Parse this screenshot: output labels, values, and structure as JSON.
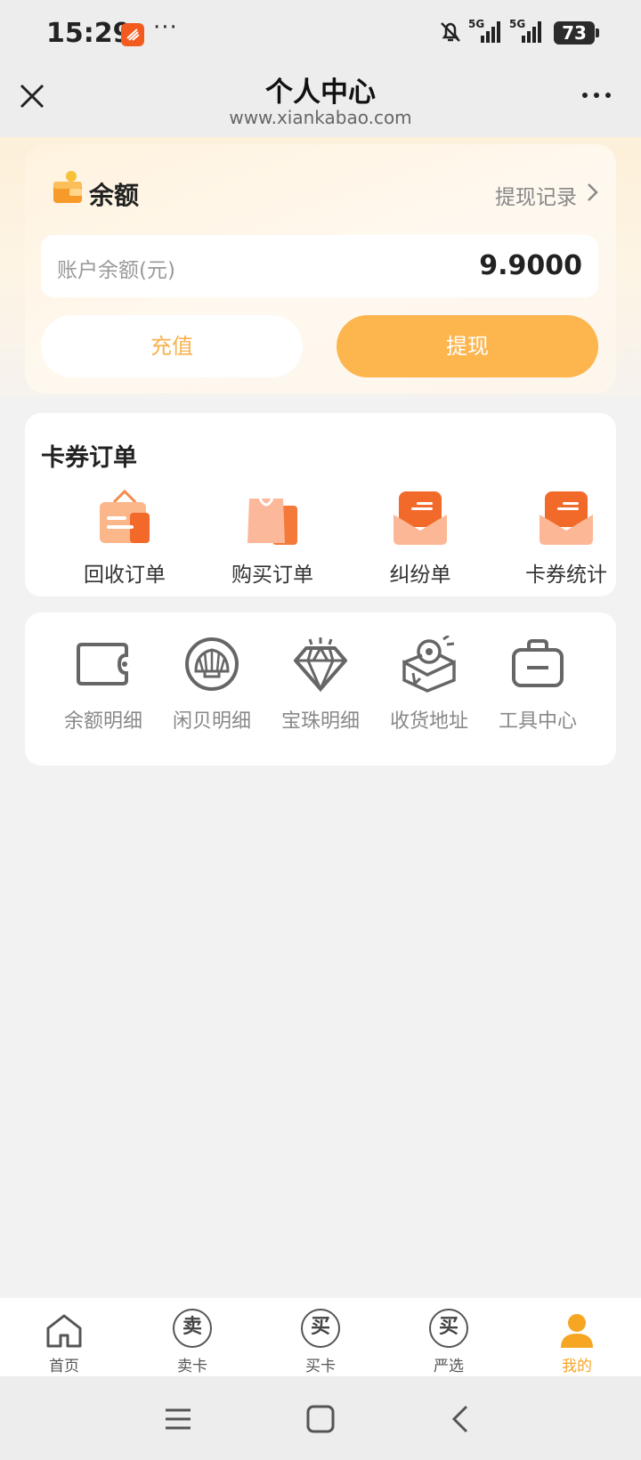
{
  "status_bar": {
    "time": "15:29",
    "dots": "···",
    "network_1": "5G",
    "network_2": "5G",
    "battery": "73"
  },
  "header": {
    "title": "个人中心",
    "url": "www.xiankabao.com"
  },
  "balance": {
    "title": "余额",
    "record_link": "提现记录",
    "account_label": "账户余额(元)",
    "account_value": "9.9000",
    "recharge_label": "充值",
    "withdraw_label": "提现"
  },
  "orders": {
    "title": "卡券订单",
    "items": [
      {
        "label": "回收订单",
        "icon": "recycle-order-icon"
      },
      {
        "label": "购买订单",
        "icon": "shopping-bag-icon"
      },
      {
        "label": "纠纷单",
        "icon": "dispute-envelope-icon"
      },
      {
        "label": "卡券统计",
        "icon": "stats-envelope-icon"
      }
    ]
  },
  "tools": {
    "items": [
      {
        "label": "余额明细",
        "icon": "wallet-icon"
      },
      {
        "label": "闲贝明细",
        "icon": "shell-icon"
      },
      {
        "label": "宝珠明细",
        "icon": "diamond-icon"
      },
      {
        "label": "收货地址",
        "icon": "location-box-icon"
      },
      {
        "label": "工具中心",
        "icon": "toolbox-icon"
      }
    ]
  },
  "tabbar": {
    "items": [
      {
        "label": "首页",
        "glyph": ""
      },
      {
        "label": "卖卡",
        "glyph": "卖"
      },
      {
        "label": "买卡",
        "glyph": "买"
      },
      {
        "label": "严选",
        "glyph": "买"
      },
      {
        "label": "我的",
        "glyph": ""
      }
    ],
    "active_color": "#f6a623"
  },
  "colors": {
    "accent": "#fdb54e",
    "recharge_text": "#f9b24d"
  }
}
